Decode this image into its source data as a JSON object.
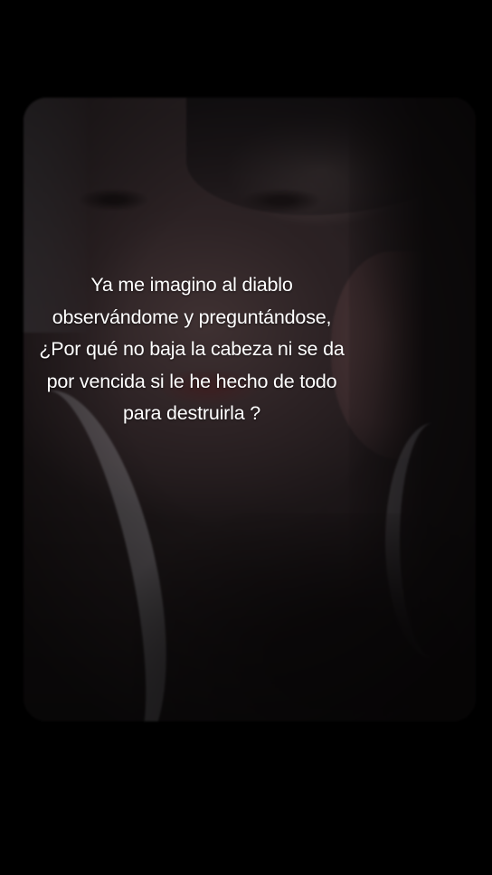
{
  "caption": {
    "lines": [
      "Ya me imagino al diablo",
      "observándome y preguntándose,",
      "¿Por qué no baja la cabeza ni se da",
      "por vencida si le he hecho de todo",
      "para destruirla ?"
    ]
  },
  "photo": {
    "subject": "dimmed-selfie-photo"
  },
  "colors": {
    "background": "#000000",
    "caption_text": "#ffffff"
  }
}
